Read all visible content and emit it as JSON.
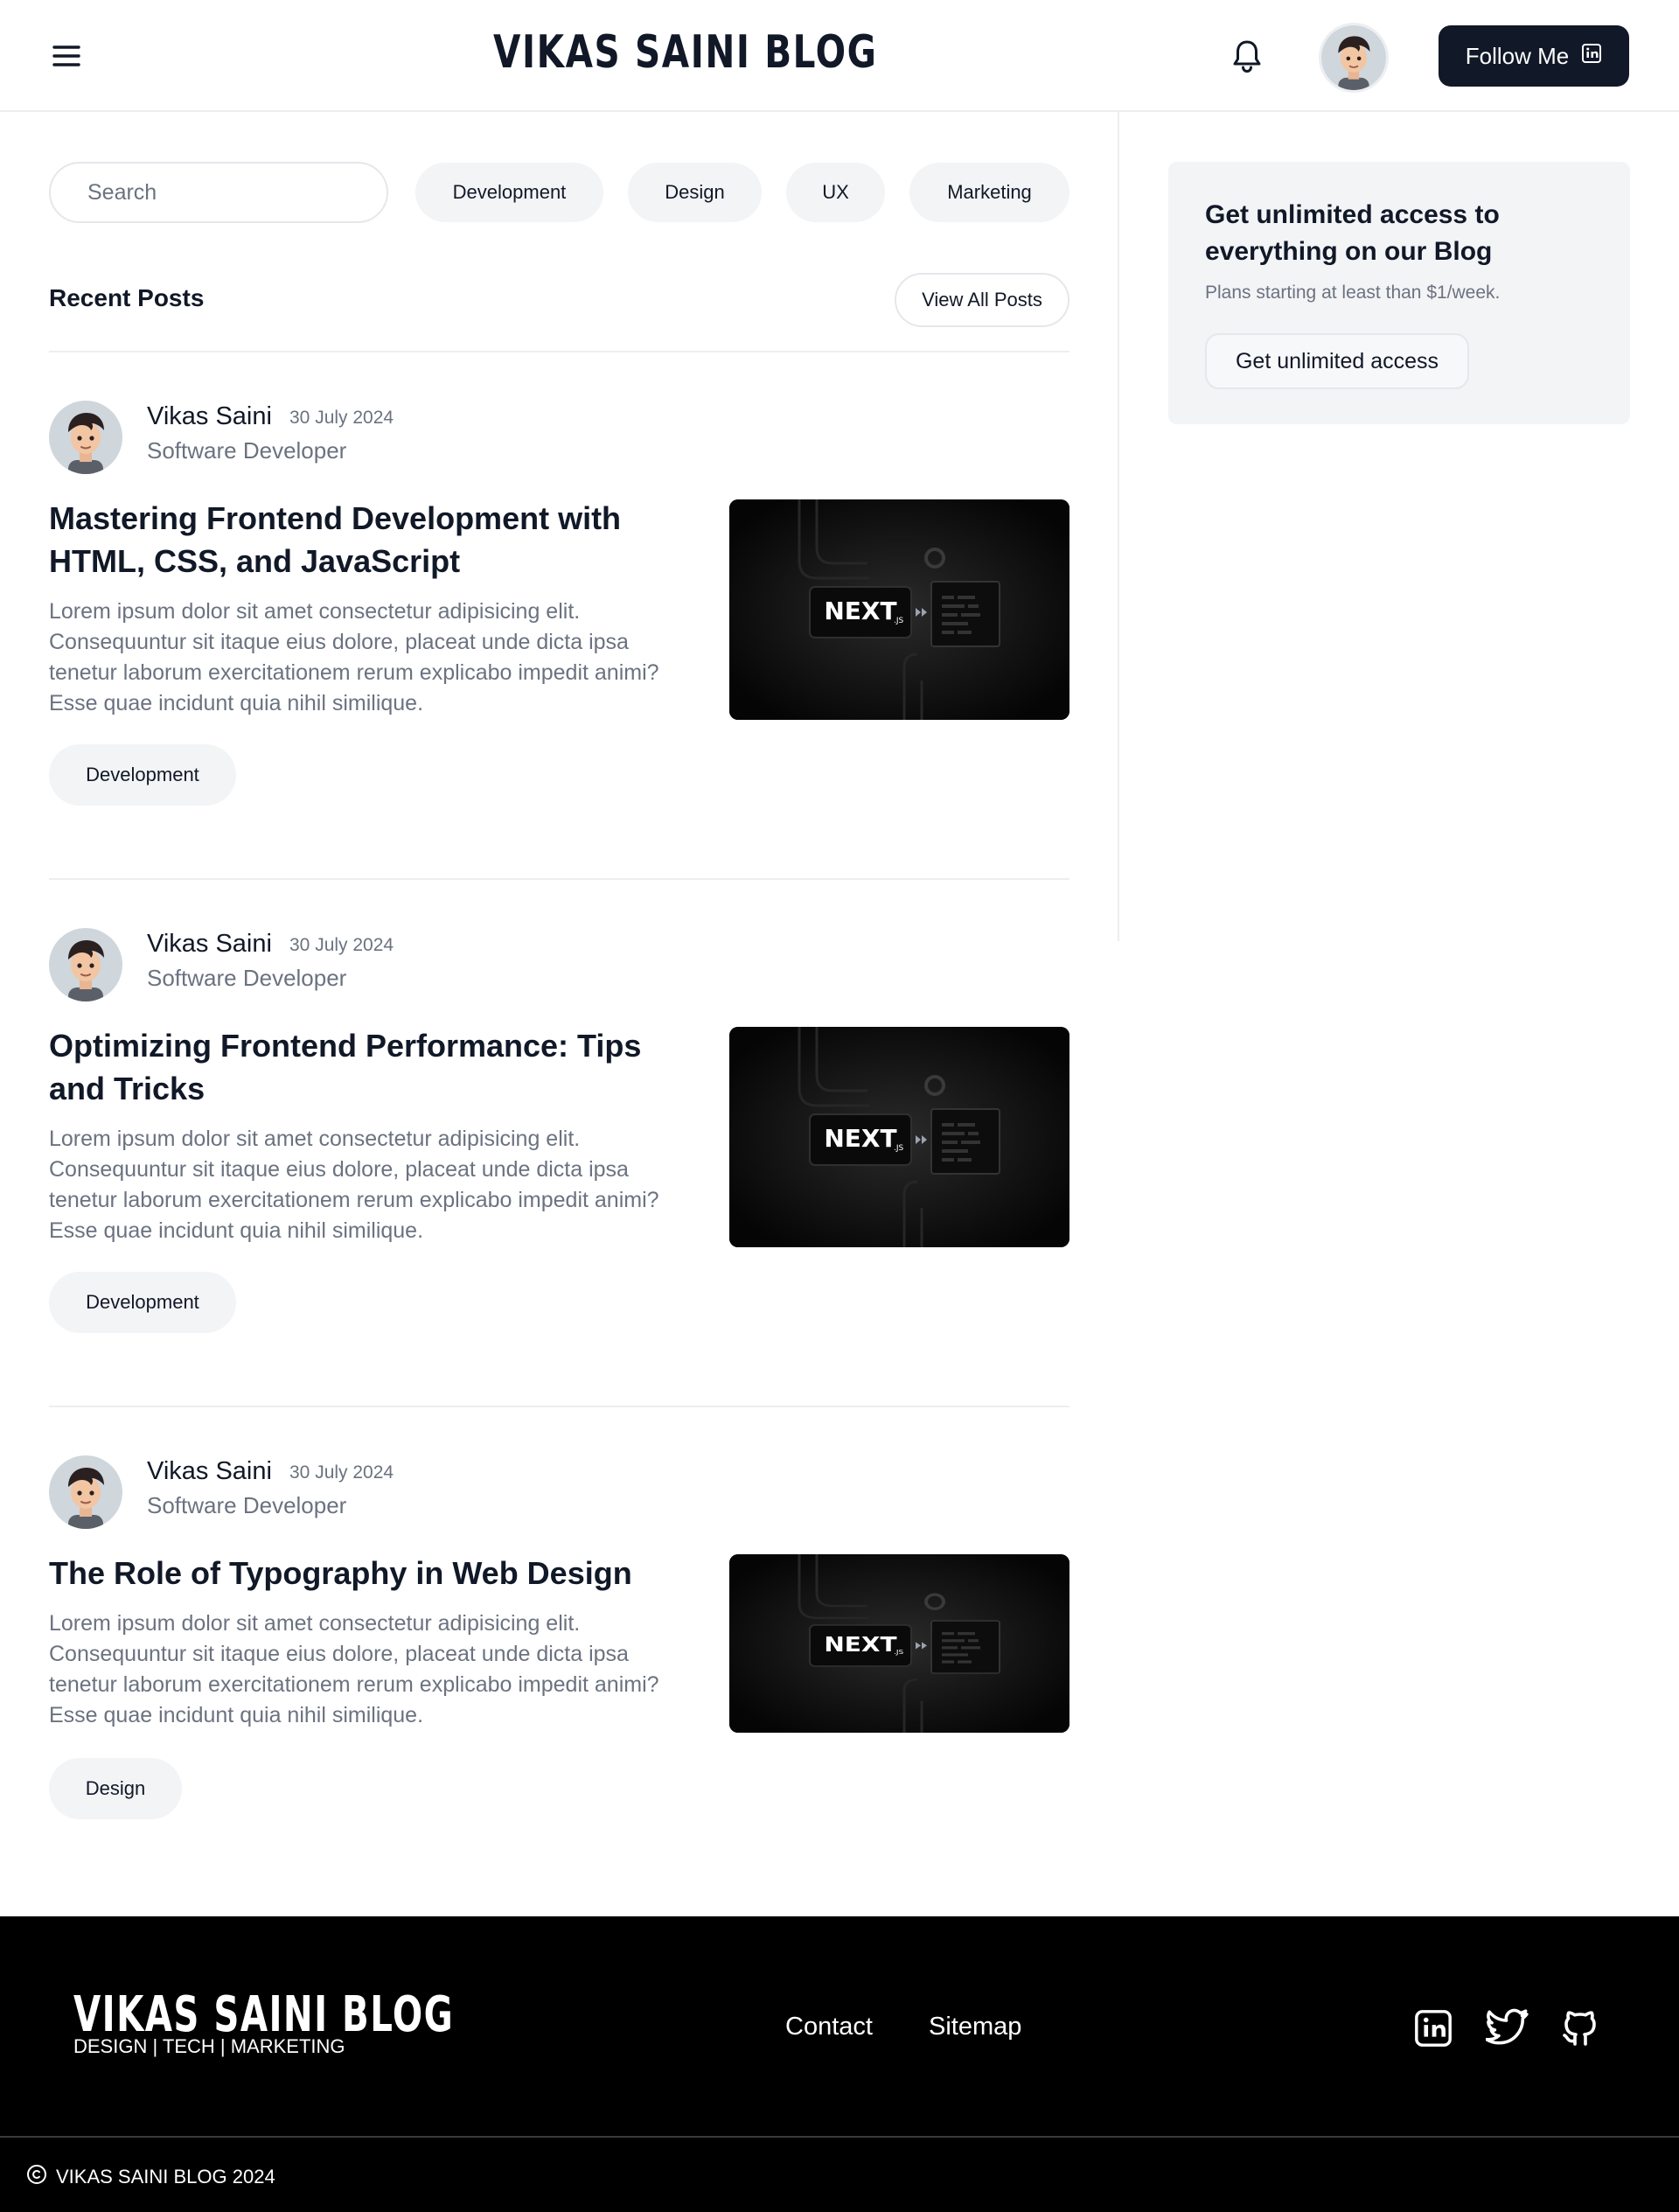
{
  "header": {
    "brand": "VIKAS SAINI BLOG",
    "follow_label": "Follow Me",
    "icons": {
      "menu": "hamburger-menu-icon",
      "notifications": "bell-icon",
      "follow": "linkedin-icon"
    }
  },
  "filters": {
    "search_placeholder": "Search",
    "chips": [
      {
        "label": "Development"
      },
      {
        "label": "Design"
      },
      {
        "label": "UX"
      },
      {
        "label": "Marketing"
      }
    ]
  },
  "recent": {
    "title": "Recent Posts",
    "view_all_label": "View All Posts"
  },
  "posts": [
    {
      "author": "Vikas Saini",
      "date": "30 July 2024",
      "role": "Software Developer",
      "title": "Mastering Frontend Development with HTML, CSS, and JavaScript",
      "excerpt": "Lorem ipsum dolor sit amet consectetur adipisicing elit. Consequuntur sit itaque eius dolore, placeat unde dicta ipsa tenetur laborum exercitationem rerum explicabo impedit animi? Esse quae incidunt quia nihil similique.",
      "tag": "Development",
      "thumbnail": {
        "logo": "NEXT",
        "logo_suffix": ".JS"
      }
    },
    {
      "author": "Vikas Saini",
      "date": "30 July 2024",
      "role": "Software Developer",
      "title": "Optimizing Frontend Performance: Tips and Tricks",
      "excerpt": "Lorem ipsum dolor sit amet consectetur adipisicing elit. Consequuntur sit itaque eius dolore, placeat unde dicta ipsa tenetur laborum exercitationem rerum explicabo impedit animi? Esse quae incidunt quia nihil similique.",
      "tag": "Development",
      "thumbnail": {
        "logo": "NEXT",
        "logo_suffix": ".JS"
      }
    },
    {
      "author": "Vikas Saini",
      "date": "30 July 2024",
      "role": "Software Developer",
      "title": "The Role of Typography in Web Design",
      "excerpt": "Lorem ipsum dolor sit amet consectetur adipisicing elit. Consequuntur sit itaque eius dolore, placeat unde dicta ipsa tenetur laborum exercitationem rerum explicabo impedit animi? Esse quae incidunt quia nihil similique.",
      "tag": "Design",
      "thumbnail": {
        "logo": "NEXT",
        "logo_suffix": ".JS"
      }
    }
  ],
  "promo": {
    "title": "Get unlimited access to everything on our Blog",
    "subtitle": "Plans starting at least than $1/week.",
    "button_label": "Get unlimited access"
  },
  "footer": {
    "brand": "VIKAS SAINI BLOG",
    "tagline": "DESIGN | TECH | MARKETING",
    "links": [
      {
        "label": "Contact"
      },
      {
        "label": "Sitemap"
      }
    ],
    "social_icons": [
      "linkedin-icon",
      "twitter-icon",
      "github-icon"
    ],
    "copyright": "VIKAS SAINI BLOG 2024"
  },
  "colors": {
    "ink": "#111827",
    "muted": "#6b7280",
    "chip_bg": "#f3f4f6",
    "border": "#e5e7eb",
    "footer_bg": "#000000"
  }
}
